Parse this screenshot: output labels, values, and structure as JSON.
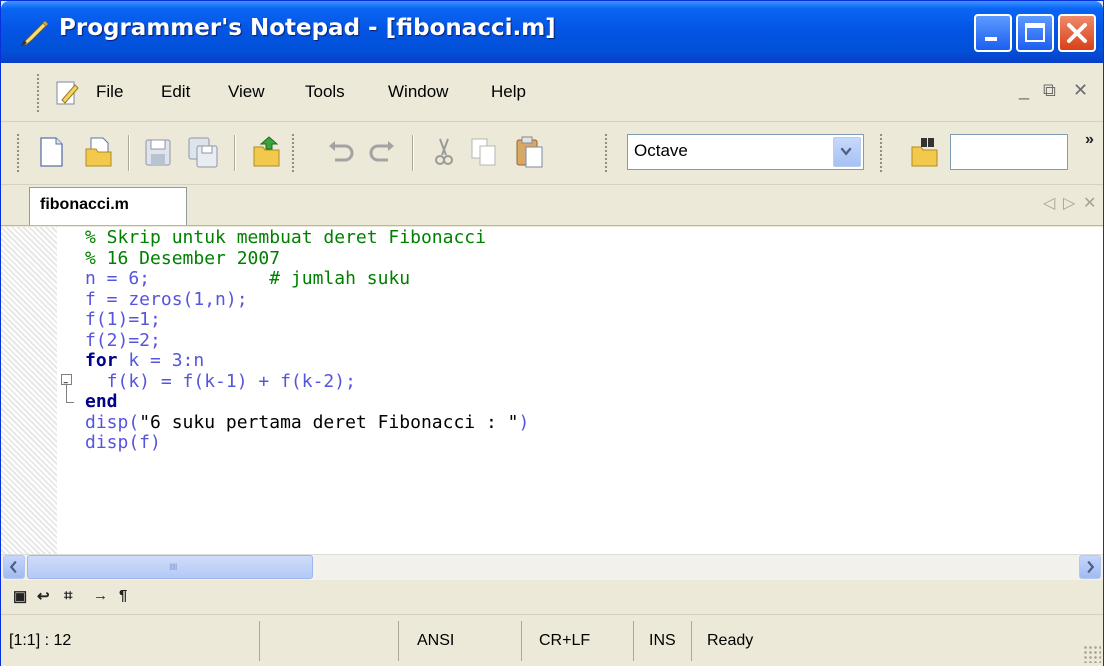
{
  "window": {
    "title": "Programmer's Notepad - [fibonacci.m]",
    "title_icon": "notepad-pen-icon",
    "controls": [
      "minimize-icon",
      "maximize-icon",
      "close-icon"
    ]
  },
  "menubar": {
    "items": [
      "File",
      "Edit",
      "View",
      "Tools",
      "Window",
      "Help"
    ],
    "mdi_controls": [
      "minimize-icon",
      "restore-icon",
      "close-icon"
    ],
    "mdi_glyphs": {
      "minimize": "_",
      "restore": "⧉",
      "close": "✕"
    }
  },
  "toolbar": {
    "buttons": [
      "new-file-icon",
      "open-file-icon",
      "save-icon",
      "save-all-icon",
      "open-project-icon",
      "undo-icon",
      "redo-icon",
      "cut-icon",
      "copy-icon",
      "paste-icon",
      "find-icon"
    ],
    "scheme_select": {
      "value": "Octave"
    },
    "find_input": {
      "value": "",
      "placeholder": ""
    },
    "overflow": "»"
  },
  "tabs": {
    "items": [
      {
        "label": "fibonacci.m",
        "active": true
      }
    ],
    "nav_glyphs": {
      "prev": "◁",
      "next": "▷",
      "close": "✕"
    }
  },
  "editor": {
    "lines": [
      [
        {
          "t": "% Skrip untuk membuat deret Fibonacci",
          "c": "c-com"
        }
      ],
      [
        {
          "t": "% 16 Desember 2007",
          "c": "c-com"
        }
      ],
      [
        {
          "t": "n = 6;",
          "c": "c-id"
        },
        {
          "t": "           # jumlah suku",
          "c": "c-com"
        }
      ],
      [
        {
          "t": "f = zeros(1,n);",
          "c": "c-id"
        }
      ],
      [
        {
          "t": "f(1)=1;",
          "c": "c-id"
        }
      ],
      [
        {
          "t": "f(2)=2;",
          "c": "c-id"
        }
      ],
      [
        {
          "t": "for",
          "c": "c-kw"
        },
        {
          "t": " k = 3:n",
          "c": "c-id"
        }
      ],
      [
        {
          "t": "  f(k) = f(k-1) + f(k-2);",
          "c": "c-id"
        }
      ],
      [
        {
          "t": "end",
          "c": "c-kw"
        }
      ],
      [
        {
          "t": "disp(",
          "c": "c-id"
        },
        {
          "t": "\"6 suku pertama deret Fibonacci : \"",
          "c": "c-blk"
        },
        {
          "t": ")",
          "c": "c-id"
        }
      ],
      [
        {
          "t": "disp(f)",
          "c": "c-id"
        }
      ]
    ]
  },
  "scrollbar": {
    "left": "<",
    "right": ">",
    "grip": "IIIII"
  },
  "mini_toolbar": {
    "glyphs": [
      "▣",
      "↩",
      "⌗",
      "→",
      "¶"
    ],
    "names": [
      "wordwrap-toggle-icon",
      "line-endings-icon",
      "whitespace-icon",
      "tab-icon",
      "paragraph-icon"
    ]
  },
  "statusbar": {
    "position": "[1:1] : 12",
    "encoding": "ANSI",
    "line_endings": "CR+LF",
    "insert_mode": "INS",
    "state": "Ready"
  }
}
